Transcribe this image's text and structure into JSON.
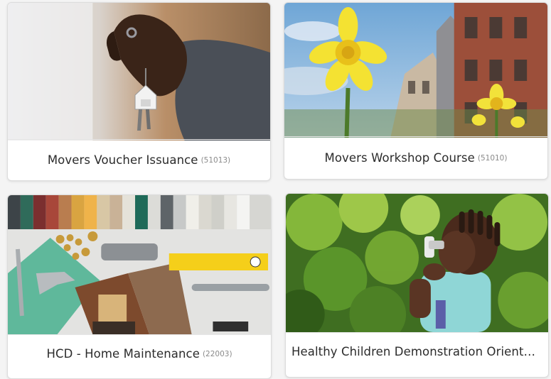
{
  "courses": [
    {
      "title": "Movers Voucher Issuance",
      "code": "(51013)",
      "image": "hand-holding-house-keychain"
    },
    {
      "title": "Movers Workshop Course",
      "code": "(51010)",
      "image": "daffodils-and-brick-houses"
    },
    {
      "title": "HCD - Home Maintenance",
      "code": "(22003)",
      "image": "home-repair-supplies-flatlay"
    },
    {
      "title": "Healthy Children Demonstration Orienta...",
      "code": "",
      "image": "child-using-inhaler"
    }
  ]
}
